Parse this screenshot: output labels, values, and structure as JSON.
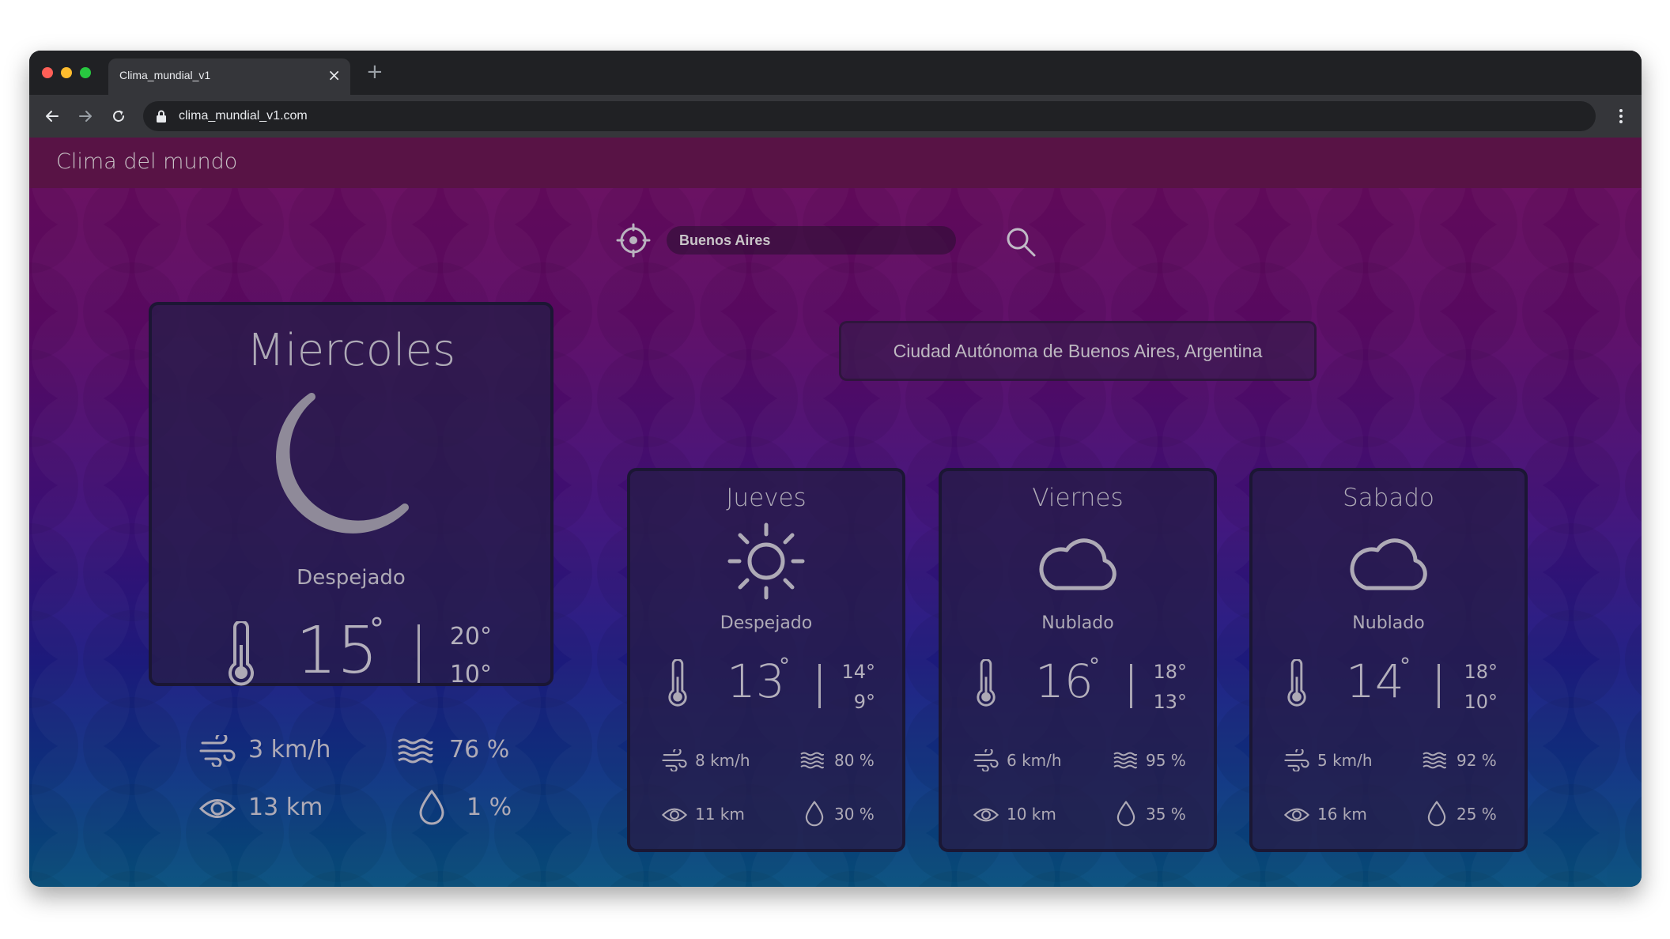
{
  "browser": {
    "tab_title": "Clima_mundial_v1",
    "tab_close": "×",
    "new_tab": "+",
    "url": "clima_mundial_v1.com",
    "traffic_colors": [
      "#ff5f57",
      "#febc2e",
      "#28c840"
    ]
  },
  "app": {
    "title": "Clima del mundo",
    "search": {
      "value": "Buenos Aires"
    },
    "location": "Ciudad Autónoma de Buenos Aires, Argentina"
  },
  "today": {
    "day": "Miercoles",
    "icon": "moon-icon",
    "condition": "Despejado",
    "temp": "15",
    "deg": "°",
    "max": "20°",
    "min": "10°",
    "wind": "3 km/h",
    "humidity": "76 %",
    "visibility": "13 km",
    "precip": "1 %"
  },
  "forecast": [
    {
      "day": "Jueves",
      "icon": "sun-icon",
      "condition": "Despejado",
      "temp": "13",
      "deg": "°",
      "max": "14°",
      "min": "9°",
      "wind": "8 km/h",
      "humidity": "80 %",
      "visibility": "11 km",
      "precip": "30 %"
    },
    {
      "day": "Viernes",
      "icon": "cloud-icon",
      "condition": "Nublado",
      "temp": "16",
      "deg": "°",
      "max": "18°",
      "min": "13°",
      "wind": "6 km/h",
      "humidity": "95 %",
      "visibility": "10 km",
      "precip": "35 %"
    },
    {
      "day": "Sabado",
      "icon": "cloud-icon",
      "condition": "Nublado",
      "temp": "14",
      "deg": "°",
      "max": "18°",
      "min": "10°",
      "wind": "5 km/h",
      "humidity": "92 %",
      "visibility": "16 km",
      "precip": "25 %"
    }
  ]
}
